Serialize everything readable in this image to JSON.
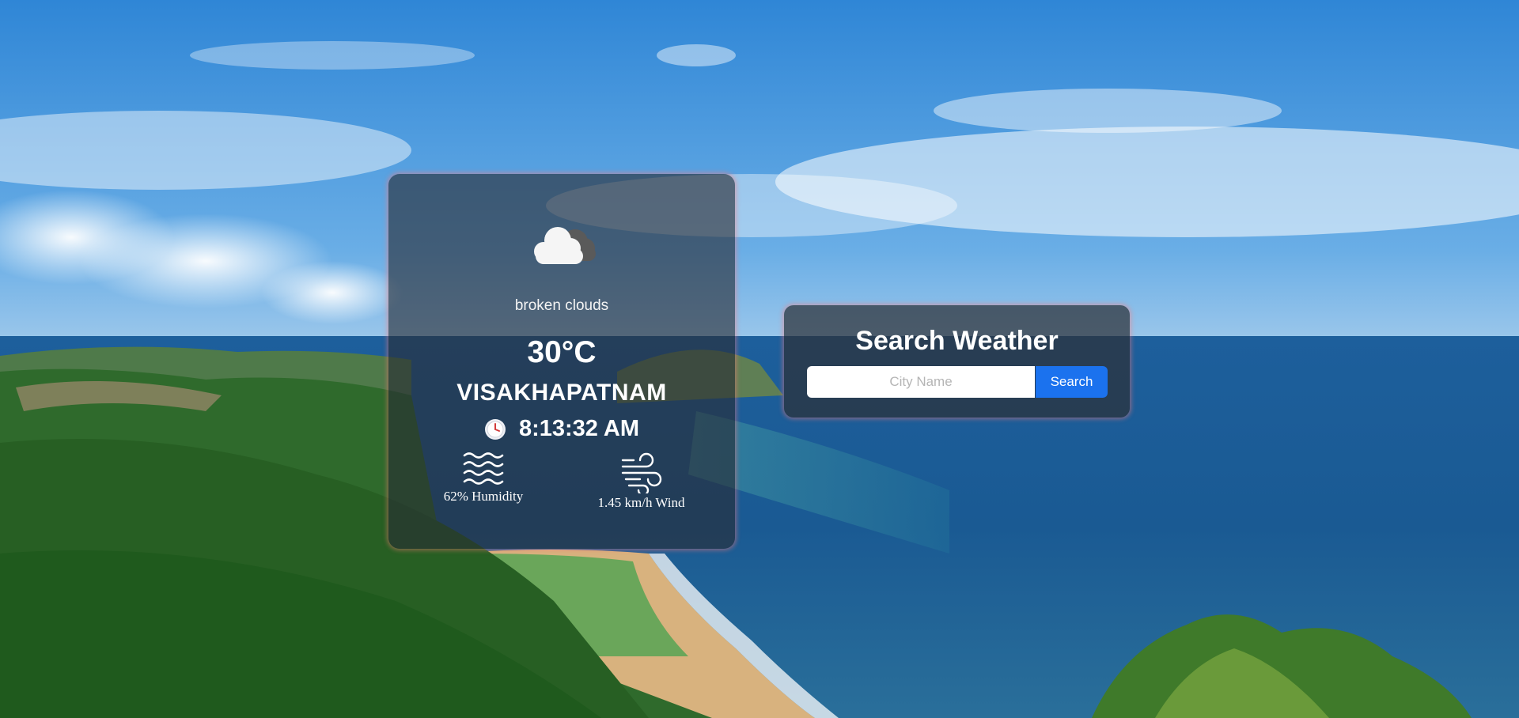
{
  "weather": {
    "icon": "cloud-icon",
    "description": "broken clouds",
    "temperature": "30°C",
    "city": "VISAKHAPATNAM",
    "time": "8:13:32 AM",
    "humidity_label": "62% Humidity",
    "wind_label": "1.45 km/h Wind"
  },
  "search": {
    "title": "Search Weather",
    "placeholder": "City Name",
    "button_label": "Search"
  },
  "colors": {
    "accent": "#1b72ee",
    "card_glow": "#ff7878"
  }
}
